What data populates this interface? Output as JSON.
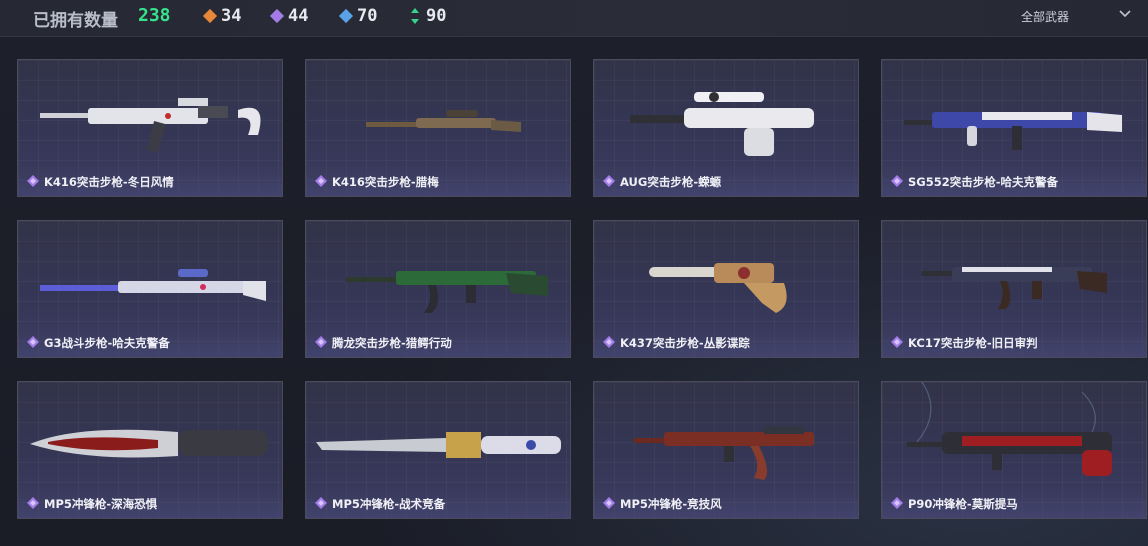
{
  "header": {
    "owned_label": "已拥有数量",
    "owned_total": "238",
    "stats": [
      {
        "icon": "orange-diamond-icon",
        "color": "#e8873a",
        "value": "34"
      },
      {
        "icon": "purple-diamond-icon",
        "color": "#a47ce8",
        "value": "44"
      },
      {
        "icon": "blue-diamond-icon",
        "color": "#5aa2e8",
        "value": "70"
      },
      {
        "icon": "green-arrows-icon",
        "color": "#36d58a",
        "value": "90"
      }
    ],
    "filter_label": "全部武器"
  },
  "cards": [
    {
      "name": "K416突击步枪-冬日风情",
      "rarity_color": "#a47ce8"
    },
    {
      "name": "K416突击步枪-腊梅",
      "rarity_color": "#a47ce8"
    },
    {
      "name": "AUG突击步枪-蝾螈",
      "rarity_color": "#a47ce8"
    },
    {
      "name": "SG552突击步枪-哈夫克警备",
      "rarity_color": "#a47ce8"
    },
    {
      "name": "G3战斗步枪-哈夫克警备",
      "rarity_color": "#a47ce8"
    },
    {
      "name": "腾龙突击步枪-猎鳄行动",
      "rarity_color": "#a47ce8"
    },
    {
      "name": "K437突击步枪-丛影谍踪",
      "rarity_color": "#a47ce8"
    },
    {
      "name": "KC17突击步枪-旧日审判",
      "rarity_color": "#a47ce8"
    },
    {
      "name": "MP5冲锋枪-深海恐惧",
      "rarity_color": "#a47ce8"
    },
    {
      "name": "MP5冲锋枪-战术竞备",
      "rarity_color": "#a47ce8"
    },
    {
      "name": "MP5冲锋枪-竞技风",
      "rarity_color": "#a47ce8"
    },
    {
      "name": "P90冲锋枪-莫斯提马",
      "rarity_color": "#a47ce8"
    }
  ]
}
